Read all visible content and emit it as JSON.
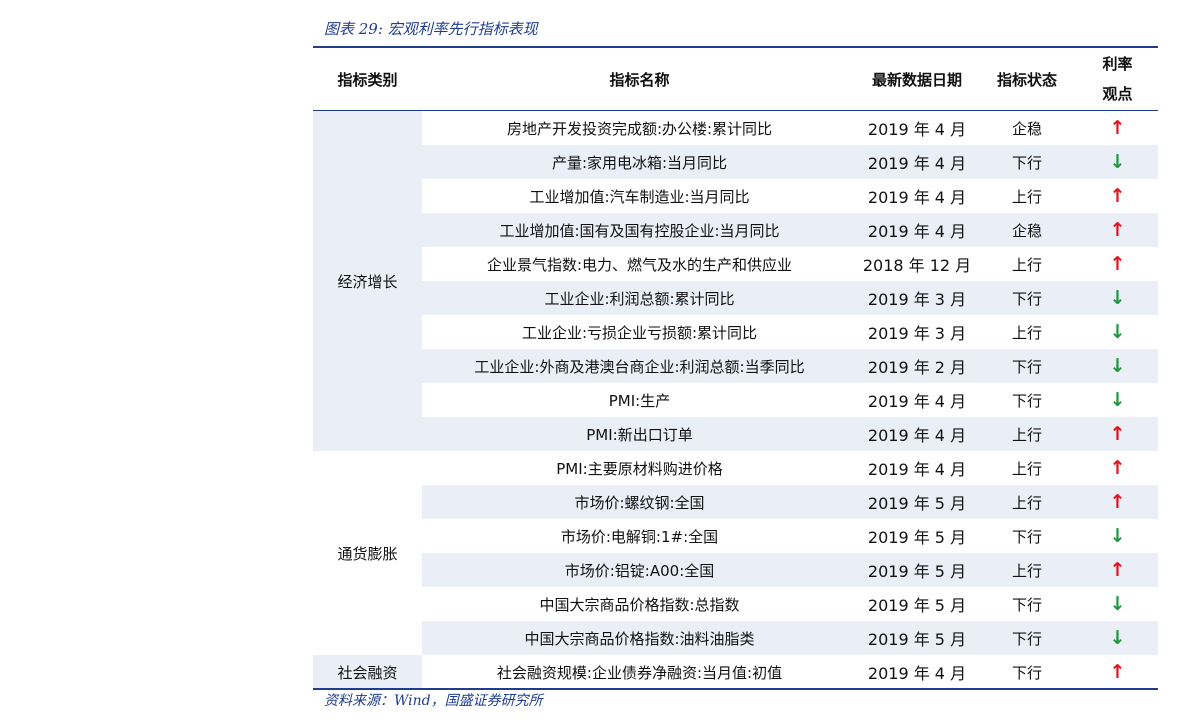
{
  "caption": "图表 29: 宏观利率先行指标表现",
  "headers": {
    "category": "指标类别",
    "name": "指标名称",
    "date": "最新数据日期",
    "status": "指标状态",
    "view_line1": "利率",
    "view_line2": "观点"
  },
  "categories": [
    {
      "label": "经济增长"
    },
    {
      "label": "通货膨胀"
    },
    {
      "label": "社会融资"
    }
  ],
  "rows": [
    {
      "name": "房地产开发投资完成额:办公楼:累计同比",
      "date": "2019 年 4 月",
      "status": "企稳",
      "view": "up"
    },
    {
      "name": "产量:家用电冰箱:当月同比",
      "date": "2019 年 4 月",
      "status": "下行",
      "view": "down"
    },
    {
      "name": "工业增加值:汽车制造业:当月同比",
      "date": "2019 年 4 月",
      "status": "上行",
      "view": "up"
    },
    {
      "name": "工业增加值:国有及国有控股企业:当月同比",
      "date": "2019 年 4 月",
      "status": "企稳",
      "view": "up"
    },
    {
      "name": "企业景气指数:电力、燃气及水的生产和供应业",
      "date": "2018 年 12 月",
      "status": "上行",
      "view": "up"
    },
    {
      "name": "工业企业:利润总额:累计同比",
      "date": "2019 年 3 月",
      "status": "下行",
      "view": "down"
    },
    {
      "name": "工业企业:亏损企业亏损额:累计同比",
      "date": "2019 年 3 月",
      "status": "上行",
      "view": "down"
    },
    {
      "name": "工业企业:外商及港澳台商企业:利润总额:当季同比",
      "date": "2019 年 2 月",
      "status": "下行",
      "view": "down"
    },
    {
      "name": "PMI:生产",
      "date": "2019 年 4 月",
      "status": "下行",
      "view": "down"
    },
    {
      "name": "PMI:新出口订单",
      "date": "2019 年 4 月",
      "status": "上行",
      "view": "up"
    },
    {
      "name": "PMI:主要原材料购进价格",
      "date": "2019 年 4 月",
      "status": "上行",
      "view": "up"
    },
    {
      "name": "市场价:螺纹钢:全国",
      "date": "2019 年 5 月",
      "status": "上行",
      "view": "up"
    },
    {
      "name": "市场价:电解铜:1#:全国",
      "date": "2019 年 5 月",
      "status": "下行",
      "view": "down"
    },
    {
      "name": "市场价:铝锭:A00:全国",
      "date": "2019 年 5 月",
      "status": "上行",
      "view": "up"
    },
    {
      "name": "中国大宗商品价格指数:总指数",
      "date": "2019 年 5 月",
      "status": "下行",
      "view": "down"
    },
    {
      "name": "中国大宗商品价格指数:油料油脂类",
      "date": "2019 年 5 月",
      "status": "下行",
      "view": "down"
    },
    {
      "name": "社会融资规模:企业债券净融资:当月值:初值",
      "date": "2019 年 4 月",
      "status": "下行",
      "view": "up"
    }
  ],
  "icons": {
    "up": "↑",
    "down": "↓"
  },
  "colors": {
    "accent": "#1f3d8f",
    "shade": "#e9eef7",
    "up": "#e3131b",
    "down": "#1a9b3c"
  },
  "source": "资料来源：Wind，国盛证券研究所"
}
